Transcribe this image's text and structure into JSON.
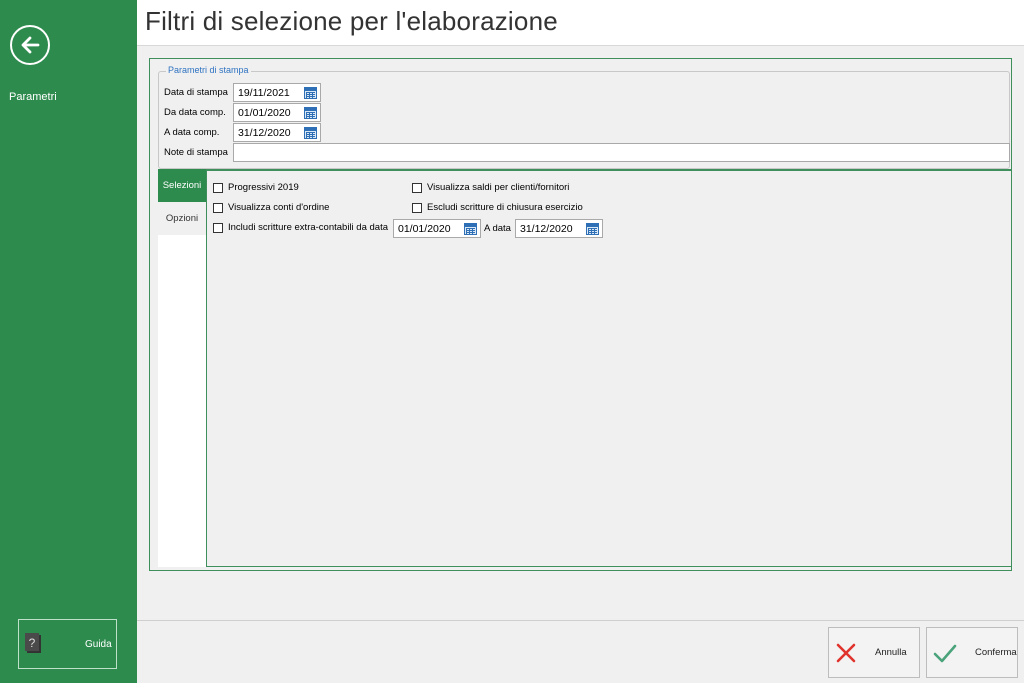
{
  "sidebar": {
    "back_icon": "arrow-left-circle-icon",
    "items": [
      {
        "label": "Parametri"
      }
    ],
    "help": {
      "label": "Guida",
      "icon": "help-book-icon"
    }
  },
  "header": {
    "title": "Filtri di selezione per l'elaborazione"
  },
  "print_params": {
    "legend": "Parametri di stampa",
    "print_date": {
      "label": "Data di stampa",
      "value": "19/11/2021"
    },
    "from_comp_date": {
      "label": "Da data comp.",
      "value": "01/01/2020"
    },
    "to_comp_date": {
      "label": "A data comp.",
      "value": "31/12/2020"
    },
    "notes": {
      "label": "Note di stampa",
      "value": ""
    }
  },
  "tabs": [
    {
      "label": "Selezioni",
      "active": true
    },
    {
      "label": "Opzioni",
      "active": false
    }
  ],
  "selections": {
    "progressivi": {
      "label": "Progressivi 2019",
      "checked": false
    },
    "saldi": {
      "label": "Visualizza saldi per clienti/fornitori",
      "checked": false
    },
    "conti_ordine": {
      "label": "Visualizza conti d'ordine",
      "checked": false
    },
    "escludi_chiusura": {
      "label": "Escludi scritture di chiusura esercizio",
      "checked": false
    },
    "includi_extra": {
      "label": "Includi  scritture extra-contabili da data",
      "checked": false
    },
    "extra_from_date": "01/01/2020",
    "extra_to_label": "A data",
    "extra_to_date": "31/12/2020"
  },
  "footer": {
    "cancel": {
      "label": "Annulla",
      "icon": "x-icon",
      "color": "#e0332d"
    },
    "confirm": {
      "label": "Conferma",
      "icon": "checkmark-icon",
      "color": "#4aa37a"
    }
  },
  "colors": {
    "accent": "#2e8b4e",
    "legend": "#2f73c2",
    "calendar": "#2f6fb5"
  }
}
